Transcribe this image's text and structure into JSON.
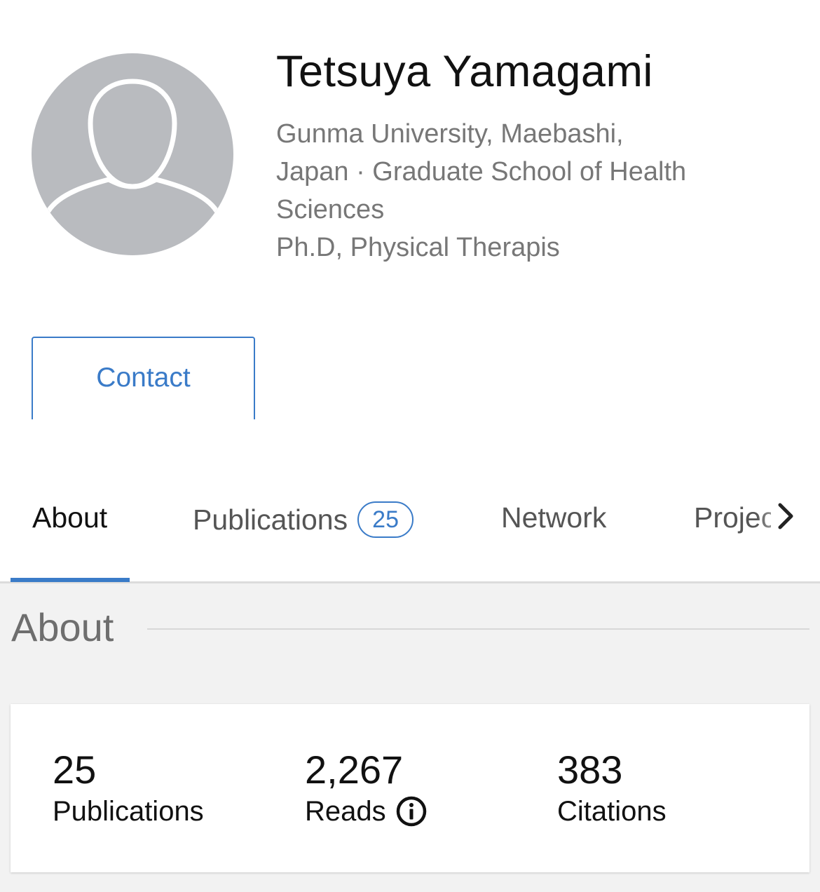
{
  "profile": {
    "name": "Tetsuya Yamagami",
    "affiliation_lines": [
      "Gunma University, Maebashi,",
      "Japan · Graduate School of Health",
      "Sciences"
    ],
    "degree": "Ph.D, Physical Therapis",
    "avatar_icon": "default-person-icon"
  },
  "actions": {
    "contact_label": "Contact"
  },
  "tabs": [
    {
      "label": "About",
      "active": true
    },
    {
      "label": "Publications",
      "badge": "25"
    },
    {
      "label": "Network"
    },
    {
      "label": "Projects"
    }
  ],
  "tabs_more_icon": "chevron-right-icon",
  "about": {
    "title": "About",
    "stats": [
      {
        "value": "25",
        "label": "Publications"
      },
      {
        "value": "2,267",
        "label": "Reads",
        "icon": "info-icon"
      },
      {
        "value": "383",
        "label": "Citations"
      }
    ]
  },
  "colors": {
    "accent": "#3a7bc8",
    "avatar_bg": "#b9bbbf",
    "section_bg": "#f2f2f2"
  }
}
